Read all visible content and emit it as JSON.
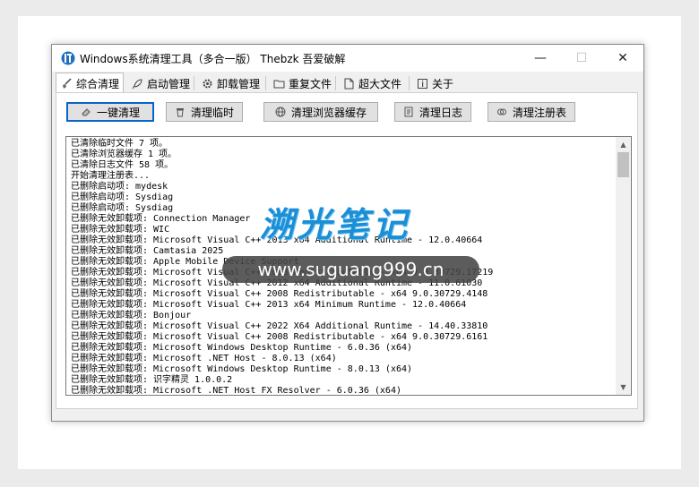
{
  "window": {
    "title": "Windows系统清理工具（多合一版）  Thebzk 吾爱破解",
    "app_icon": "app-logo-icon",
    "minimize": "—",
    "maximize": "☐",
    "close": "✕"
  },
  "tabs": [
    {
      "label": "综合清理",
      "icon": "broom-icon"
    },
    {
      "label": "启动管理",
      "icon": "rocket-icon"
    },
    {
      "label": "卸载管理",
      "icon": "gear-icon"
    },
    {
      "label": "重复文件",
      "icon": "folder-icon"
    },
    {
      "label": "超大文件",
      "icon": "document-icon"
    },
    {
      "label": "关于",
      "icon": "info-icon"
    }
  ],
  "buttons": [
    {
      "label": "一键清理",
      "icon": "eraser-icon"
    },
    {
      "label": "清理临时",
      "icon": "trash-icon"
    },
    {
      "label": "清理浏览器缓存",
      "icon": "globe-icon"
    },
    {
      "label": "清理日志",
      "icon": "log-icon"
    },
    {
      "label": "清理注册表",
      "icon": "registry-icon"
    }
  ],
  "log": [
    "已清除临时文件 7 项。",
    "已清除浏览器缓存 1 项。",
    "已清除日志文件 58 项。",
    "开始清理注册表...",
    "已删除启动项: mydesk",
    "已删除启动项: Sysdiag",
    "已删除启动项: Sysdiag",
    "已删除无效卸载项: Connection Manager",
    "已删除无效卸载项: WIC",
    "已删除无效卸载项: Microsoft Visual C++ 2013 x64 Additional Runtime - 12.0.40664",
    "已删除无效卸载项: Camtasia 2025",
    "已删除无效卸载项: Apple Mobile Device Support",
    "已删除无效卸载项: Microsoft Visual C++ 2008 Redistributable - x64 9.0.30729.17219",
    "已删除无效卸载项: Microsoft Visual C++ 2012 x64 Additional Runtime - 11.0.61030",
    "已删除无效卸载项: Microsoft Visual C++ 2008 Redistributable - x64 9.0.30729.4148",
    "已删除无效卸载项: Microsoft Visual C++ 2013 x64 Minimum Runtime - 12.0.40664",
    "已删除无效卸载项: Bonjour",
    "已删除无效卸载项: Microsoft Visual C++ 2022 X64 Additional Runtime - 14.40.33810",
    "已删除无效卸载项: Microsoft Visual C++ 2008 Redistributable - x64 9.0.30729.6161",
    "已删除无效卸载项: Microsoft Windows Desktop Runtime - 6.0.36 (x64)",
    "已删除无效卸载项: Microsoft .NET Host - 8.0.13 (x64)",
    "已删除无效卸载项: Microsoft Windows Desktop Runtime - 8.0.13 (x64)",
    "已删除无效卸载项: 识字精灵 1.0.0.2",
    "已删除无效卸载项: Microsoft .NET Host FX Resolver - 6.0.36 (x64)"
  ],
  "watermark": {
    "brand": "溯光笔记",
    "url": "www.suguang999.cn"
  },
  "colors": {
    "accent": "#0a64c8",
    "watermark_blue": "#1b8fd6"
  }
}
